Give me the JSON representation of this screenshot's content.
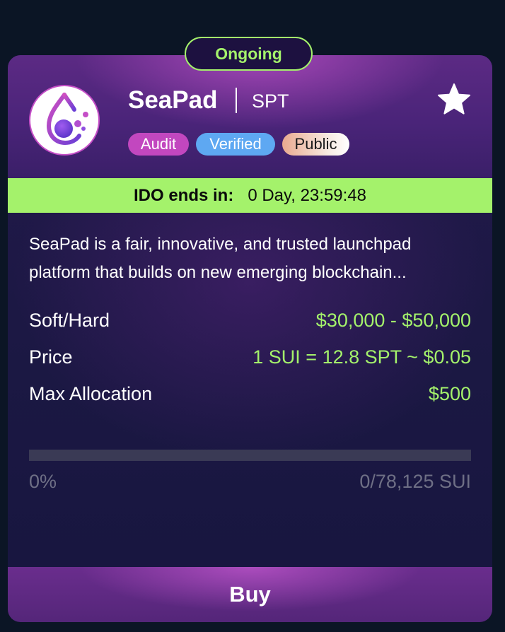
{
  "card": {
    "status": "Ongoing",
    "project_name": "SeaPad",
    "ticker": "SPT",
    "logo_icon": "seapad-droplet-logo-icon",
    "favorite_icon": "star-icon",
    "tags": [
      {
        "label": "Audit",
        "color": "#c247bf"
      },
      {
        "label": "Verified",
        "color": "#5ea8f2"
      },
      {
        "label": "Public",
        "color": "#f3d3c4"
      }
    ],
    "timer": {
      "label": "IDO ends in:",
      "value": "0 Day, 23:59:48"
    },
    "description": "SeaPad is a fair, innovative, and trusted launchpad platform that builds on new emerging blockchain...",
    "stats": [
      {
        "label": "Soft/Hard",
        "value": "$30,000 - $50,000"
      },
      {
        "label": "Price",
        "value": "1 SUI = 12.8 SPT ~ $0.05"
      },
      {
        "label": "Max Allocation",
        "value": "$500"
      }
    ],
    "progress": {
      "fraction": 0,
      "percent_label": "0%",
      "amount_label": "0/78,125 SUI"
    },
    "buy_label": "Buy"
  },
  "colors": {
    "accent_green": "#a4f26b",
    "background": "#0b1525",
    "card_top": "#5c2a84",
    "card_bottom": "#17163f"
  }
}
